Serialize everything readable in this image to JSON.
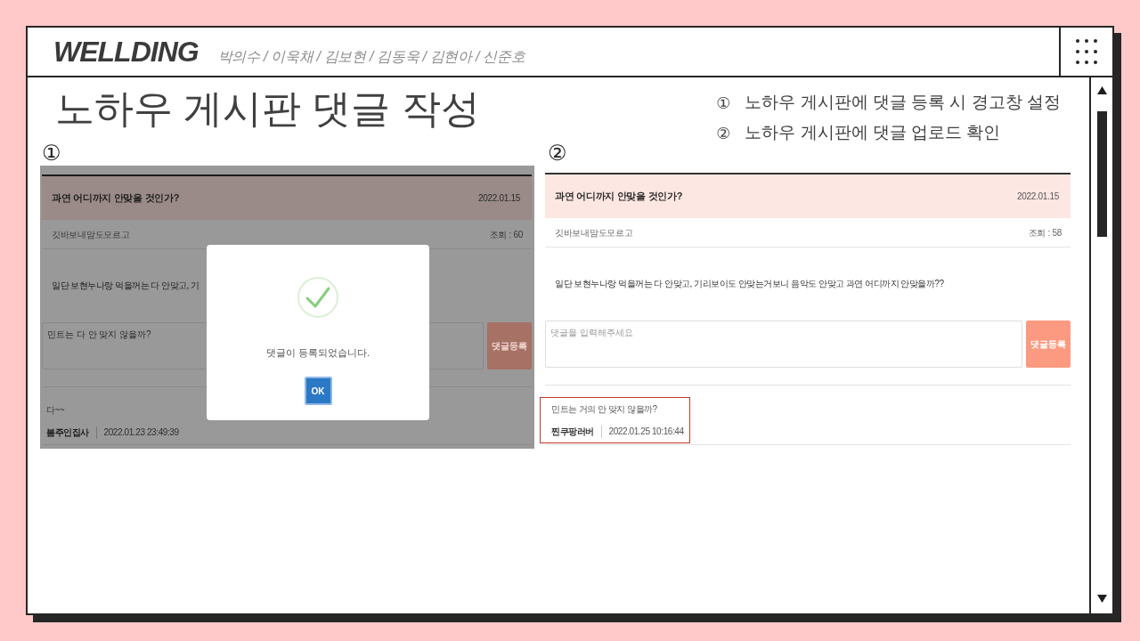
{
  "header": {
    "logo": "WELLDING",
    "members": "박의수 / 이욱채 / 김보현 / 김동욱 / 김현아 / 신준호"
  },
  "slide": {
    "title": "노하우 게시판 댓글 작성",
    "steps": [
      {
        "marker": "①",
        "text": "노하우 게시판에 댓글 등록 시 경고창 설정"
      },
      {
        "marker": "②",
        "text": "노하우 게시판에 댓글 업로드 확인"
      }
    ]
  },
  "panels": [
    {
      "marker": "①",
      "dimmed": true,
      "post": {
        "title": "과연 어디까지 안맞을 것인가?",
        "date": "2022.01.15",
        "author": "깃바보내맘도모르고",
        "views": "조회 : 60",
        "body": "일단 보현누나랑 먹을꺼는 다 안맞고, 기"
      },
      "comment_form": {
        "value": "민트는 다 안 맞지 않을까?",
        "button": "댓글등록"
      },
      "comments": [
        {
          "text": "다~~",
          "author": "봄주인집사",
          "time": "2022.01.23 23:49:39",
          "highlighted": false
        }
      ],
      "dialog": {
        "message": "댓글이 등록되었습니다.",
        "button": "OK"
      }
    },
    {
      "marker": "②",
      "dimmed": false,
      "post": {
        "title": "과연 어디까지 안맞을 것인가?",
        "date": "2022.01.15",
        "author": "깃바보내맘도모르고",
        "views": "조회 : 58",
        "body": "일단 보현누나랑 먹을꺼는 다 안맞고, 기리보이도 안맞는거보니 음악도 안맞고 과연 어디까지 안맞을까??"
      },
      "comment_form": {
        "placeholder": "댓글을 입력해주세요",
        "button": "댓글등록"
      },
      "comments": [
        {
          "text": "민트는 거의 안 맞지 않을까?",
          "author": "찐쿠팡러버",
          "time": "2022.01.25 10:16:44",
          "highlighted": true
        }
      ]
    }
  ]
}
